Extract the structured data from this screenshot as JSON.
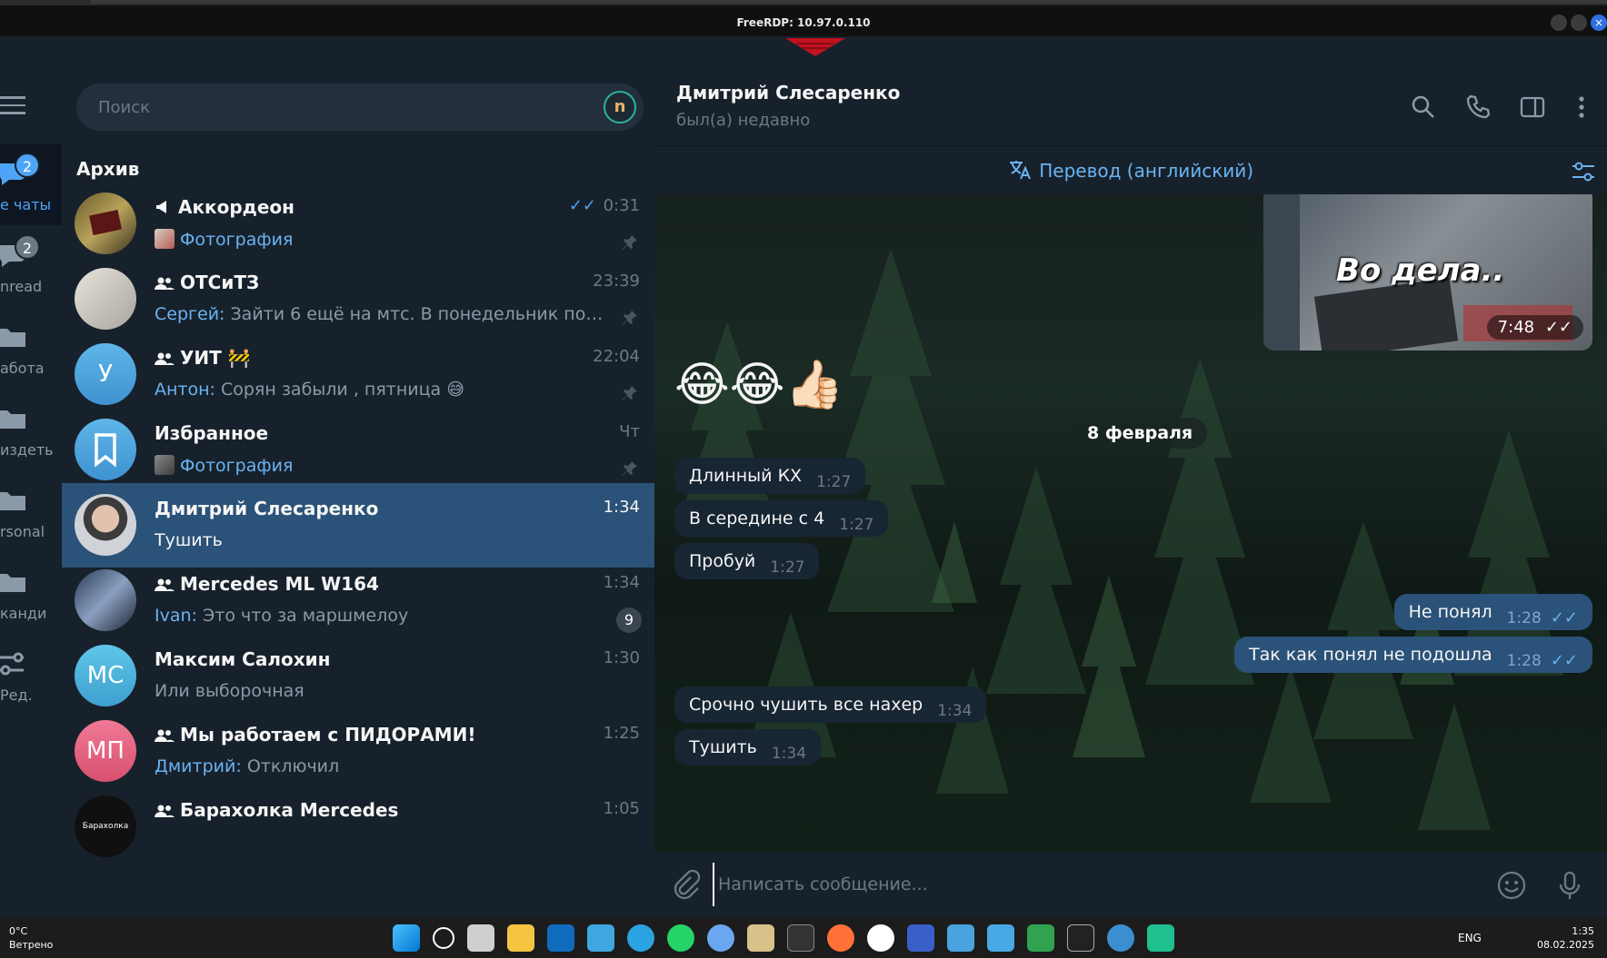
{
  "rdp": {
    "title": "FreeRDP: 10.97.0.110"
  },
  "folders": [
    {
      "label": "е чаты",
      "badge": "2",
      "icon": "chat-bubbles-icon",
      "active": true
    },
    {
      "label": "nread",
      "badge": "2",
      "icon": "chat-bubble-icon",
      "active": false
    },
    {
      "label": "абота",
      "icon": "folder-icon"
    },
    {
      "label": "издеть",
      "icon": "folder-icon"
    },
    {
      "label": "rsonal",
      "icon": "folder-icon"
    },
    {
      "label": "канди",
      "icon": "folder-icon"
    },
    {
      "label": "Ред.",
      "icon": "sliders-icon"
    }
  ],
  "search": {
    "placeholder": "Поиск",
    "extension": "n"
  },
  "archive_title": "Архив",
  "chats": [
    {
      "name": "Аккордеон",
      "type": "channel",
      "time": "0:31",
      "read": true,
      "preview_media": "Фотография",
      "pinned": true
    },
    {
      "name": "ОТСиТЗ",
      "type": "group",
      "time": "23:39",
      "sender": "Сергей:",
      "preview": "Зайти 6 ещё на мтс. В понедельник попроб...",
      "pinned": true
    },
    {
      "name": "УИТ",
      "type": "group",
      "name_emoji": "🚧",
      "time": "22:04",
      "sender": "Антон:",
      "preview": "Сорян забыли , пятница 😅",
      "pinned": true,
      "avatar_letter": "У"
    },
    {
      "name": "Избранное",
      "time": "Чт",
      "preview_media": "Фотография",
      "pinned": true
    },
    {
      "name": "Дмитрий Слесаренко",
      "time": "1:34",
      "preview": "Тушить",
      "active": true
    },
    {
      "name": "Mercedes ML W164",
      "type": "group",
      "time": "1:34",
      "sender": "Ivan:",
      "preview": "Это что за маршмелоу",
      "unread": "9"
    },
    {
      "name": "Максим Салохин",
      "time": "1:30",
      "preview": "Или выборочная",
      "avatar_letter": "МС"
    },
    {
      "name": "Мы работаем с ПИДОРАМИ!",
      "type": "group",
      "time": "1:25",
      "sender": "Дмитрий:",
      "preview": "Отключил",
      "avatar_letter": "МП"
    },
    {
      "name": "Барахолка Mercedes",
      "type": "group",
      "time": "1:05",
      "avatar_text": "Барахолка"
    }
  ],
  "header": {
    "title": "Дмитрий Слесаренко",
    "status": "был(а) недавно"
  },
  "translate": {
    "label": "Перевод (английский)"
  },
  "photo_message": {
    "caption": "Во дела..",
    "time": "7:48"
  },
  "emoji_message": "😂😂👍🏻",
  "date_separator": "8 февраля",
  "messages": [
    {
      "text": "Длинный КХ",
      "time": "1:27",
      "out": false
    },
    {
      "text": "В середине с 4",
      "time": "1:27",
      "out": false
    },
    {
      "text": "Пробуй",
      "time": "1:27",
      "out": false
    },
    {
      "text": "Не понял",
      "time": "1:28",
      "out": true
    },
    {
      "text": "Так как понял не подошла",
      "time": "1:28",
      "out": true
    },
    {
      "text": "Срочно чушить все нахер",
      "time": "1:34",
      "out": false
    },
    {
      "text": "Тушить",
      "time": "1:34",
      "out": false
    }
  ],
  "composer": {
    "placeholder": "Написать сообщение..."
  },
  "taskbar": {
    "weather_temp": "0°C",
    "weather_desc": "Ветрено",
    "lang": "ENG",
    "time": "1:35",
    "date": "08.02.2025"
  },
  "colors": {
    "accent": "#4ea4f6",
    "active_chat": "#2b5278",
    "sidebar": "#17212b",
    "background": "#0e1621"
  }
}
